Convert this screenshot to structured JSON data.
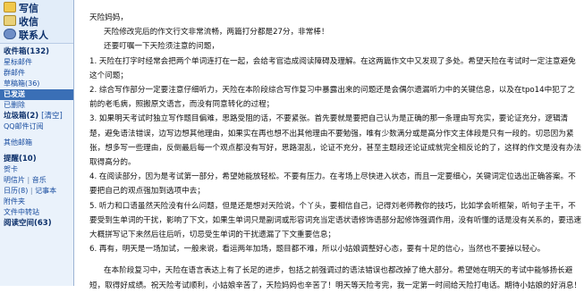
{
  "sidebar": {
    "top_buttons": [
      {
        "label": "写信",
        "icon": "pencil-icon"
      },
      {
        "label": "收信",
        "icon": "envelope-icon"
      },
      {
        "label": "联系人",
        "icon": "contacts-icon"
      }
    ],
    "inbox": "收件箱(132)",
    "starred": "星标邮件",
    "groups": "群邮件",
    "drafts": "草稿箱(36)",
    "sent": "已发送",
    "deleted": "已删除",
    "trash": "垃圾箱(2)",
    "trash_clear": "[清空]",
    "qq_ad": "QQ邮件订阅",
    "other": "其他邮箱",
    "reminder": "提醒(10)",
    "greeting": "贺卡",
    "postcard": "明信片",
    "music_card": "音乐",
    "calendar": "日历(8)",
    "memo": "记事本",
    "attachments": "附件夹",
    "file_transfer": "文件中转站",
    "reading_space": "阅读空间(63)"
  },
  "letter": {
    "greeting": "天险妈妈，",
    "intro_lines": [
      "天险修改完后的作文行文非常流畅，两篇打分都是27分，非常棒！",
      "还要叮嘱一下天险须注意的问题，"
    ],
    "points": [
      "1. 天险在打字时经常会把两个单词连打在一起，会给考官造成阅读障碍及理解。在这两篇作文中又发现了多处。希望天险在考试时一定注意避免这个问题；",
      "2. 综合写作部分一定要注意仔细听力，天险在本阶段综合写作复习中暴露出来的问题还是会偶尔遗漏听力中的关键信息，以及在tpo14中犯了之前的老毛病，照搬原文语言，而没有同意转化的过程；",
      "3. 如果明天考试时独立写作题目偏难，思路受阻的话，不要紧张。首先要就是要把自己认为是正确的那一条理由写充实，要论证充分，逻辑清楚，避免语法错误，边写边想其他理由，如果实在再也想不出其他理由不要勉强，唯有少数满分或是高分作文主体段是只有一段的。切忌因为紧张，想多写一些理由，反倒最后每一个观点都没有写好，思路混乱，论证不充分，甚至主题段还论证成就完全相反论的了，这样的作文是没有办法取得高分的。",
      "4. 在阅读部分，因为是考试第一部分，希望她能放轻松。不要有压力。在考场上尽快进入状态，而且一定要细心，关键词定位选出正确答案。不要把自己的观点强加到选项中去；",
      "5. 听力和口语虽然天险没有什么问题，但是还是想对天险说，个丫头，要相信自己，记得刘老师教你的技巧，比如学会听框架，听句子主干，不要受到生单词的干扰，影响了下文，如果生单词只是副词或形容词充当定语状语修饰语部分起修饰强调作用，没有听懂的话是没有关系的，要迅速大概拼写记下来然后往后听，切忌受生单词的干扰遗漏了下文重要信息；",
      "6. 再有，明天是一场加试，一般来说，看运两年加场，题目都不难，所以小姑娘调整好心态，要有十足的信心，当然也不要掉以轻心。"
    ],
    "closing": "在本阶段复习中，天险在语言表达上有了长足的进步，包括之前强调过的语法错误也都改掉了绝大部分。希望她在明天的考试中能够扬长避短，取得好成绩。祝天险考试顺利，小姑娘辛苦了，天险妈妈也辛苦了！明天等天险考完，我一定第一时间给天险打电话。期待小姑娘的好消息！"
  }
}
